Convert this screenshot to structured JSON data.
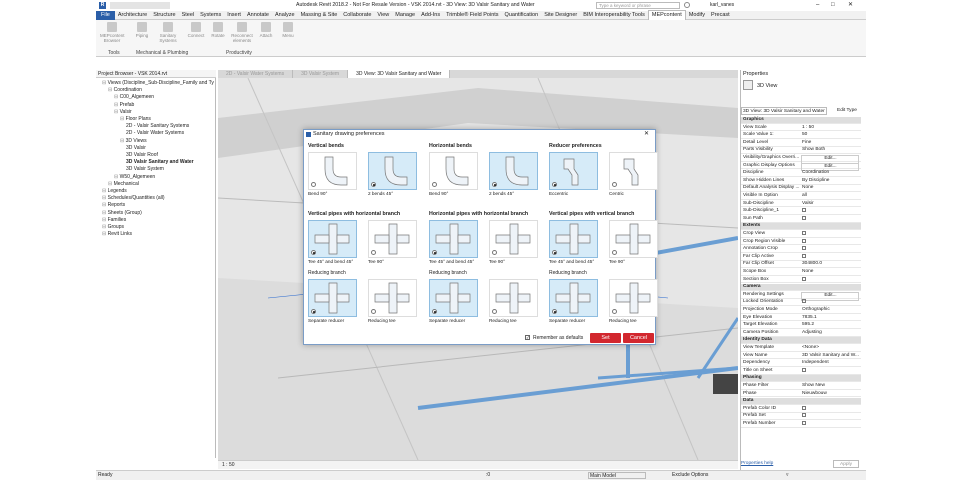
{
  "window": {
    "title": "Autodesk Revit 2018.2 - Not For Resale Version - VSK 2014.rvt - 3D View: 3D Valsir Sanitary and Water",
    "search_placeholder": "Type a keyword or phrase",
    "user": "karl_vanes"
  },
  "ribbon": {
    "tabs": [
      "File",
      "Architecture",
      "Structure",
      "Steel",
      "Systems",
      "Insert",
      "Annotate",
      "Analyze",
      "Massing & Site",
      "Collaborate",
      "View",
      "Manage",
      "Add-Ins",
      "Trimble® Field Points",
      "Quantification",
      "Site Designer",
      "BIM Interoperability Tools",
      "MEPcontent",
      "Modify",
      "Precast"
    ],
    "active_tab": "MEPcontent",
    "buttons": [
      "MEPcontent Browser",
      "Piping",
      "Sanitary Systems",
      "Connect",
      "Rotate",
      "Reconnect elements",
      "Attach",
      "Menu"
    ],
    "panels": [
      "Tools",
      "Mechanical & Plumbing",
      "Productivity"
    ]
  },
  "project_browser": {
    "title": "Project Browser - VSK 2014.rvt",
    "items": [
      {
        "label": "Views (Discipline_Sub-Discipline_Family and Ty",
        "level": 0
      },
      {
        "label": "Coordination",
        "level": 1
      },
      {
        "label": "C00_Algemeen",
        "level": 2
      },
      {
        "label": "Prefab",
        "level": 2
      },
      {
        "label": "Valsir",
        "level": 2
      },
      {
        "label": "Floor Plans",
        "level": 3
      },
      {
        "label": "2D - Valsir Sanitary Systems",
        "level": 4
      },
      {
        "label": "2D - Valsir Water Systems",
        "level": 4
      },
      {
        "label": "3D Views",
        "level": 3
      },
      {
        "label": "3D Valsir",
        "level": 4
      },
      {
        "label": "3D Valsir Roof",
        "level": 4
      },
      {
        "label": "3D Valsir Sanitary and Water",
        "level": 4,
        "bold": true
      },
      {
        "label": "3D Valsir System",
        "level": 4
      },
      {
        "label": "W50_Algemeen",
        "level": 2
      },
      {
        "label": "Mechanical",
        "level": 1
      },
      {
        "label": "Legends",
        "level": 0
      },
      {
        "label": "Schedules/Quantities (all)",
        "level": 0
      },
      {
        "label": "Reports",
        "level": 0
      },
      {
        "label": "Sheets (Group)",
        "level": 0
      },
      {
        "label": "Families",
        "level": 0
      },
      {
        "label": "Groups",
        "level": 0
      },
      {
        "label": "Revit Links",
        "level": 0
      }
    ]
  },
  "view_tabs": [
    "2D - Valsir Water Systems",
    "3D Valsir System",
    "3D View: 3D Valsir Sanitary and Water"
  ],
  "view_controls": {
    "scale": "1 : 50"
  },
  "dialog": {
    "title": "Sanitary drawing preferences",
    "sections": [
      {
        "title": "Vertical bends",
        "options": [
          {
            "caption": "Bend 90°",
            "selected": false
          },
          {
            "caption": "2 bends 45°",
            "selected": true
          }
        ]
      },
      {
        "title": "Horizontal bends",
        "options": [
          {
            "caption": "Bend 90°",
            "selected": false
          },
          {
            "caption": "2 bends 45°",
            "selected": true
          }
        ]
      },
      {
        "title": "Reducer preferences",
        "options": [
          {
            "caption": "Eccentric",
            "selected": true
          },
          {
            "caption": "Centric",
            "selected": false
          }
        ]
      },
      {
        "title": "Vertical pipes with horizontal branch",
        "options": [
          {
            "caption": "Tee 45° and bend 45°",
            "selected": true
          },
          {
            "caption": "Tee 90°",
            "selected": false
          }
        ],
        "sub_title": "Reducing branch",
        "sub_options": [
          {
            "caption": "Separate reducer",
            "selected": true
          },
          {
            "caption": "Reducing tee",
            "selected": false
          }
        ]
      },
      {
        "title": "Horizontal pipes with horizontal branch",
        "options": [
          {
            "caption": "Tee 45° and bend 45°",
            "selected": true
          },
          {
            "caption": "Tee 90°",
            "selected": false
          }
        ],
        "sub_title": "Reducing branch",
        "sub_options": [
          {
            "caption": "Separate reducer",
            "selected": true
          },
          {
            "caption": "Reducing tee",
            "selected": false
          }
        ]
      },
      {
        "title": "Vertical pipes with vertical branch",
        "options": [
          {
            "caption": "Tee 45° and bend 45°",
            "selected": true
          },
          {
            "caption": "Tee 90°",
            "selected": false
          }
        ],
        "sub_title": "Reducing branch",
        "sub_options": [
          {
            "caption": "Separate reducer",
            "selected": true
          },
          {
            "caption": "Reducing tee",
            "selected": false
          }
        ]
      }
    ],
    "remember_label": "Remember as defaults",
    "remember_checked": true,
    "set_label": "Set",
    "cancel_label": "Cancel"
  },
  "properties": {
    "title": "Properties",
    "type_name": "3D View",
    "selector": "3D View: 3D Valsir Sanitary and Water",
    "edit_type": "Edit Type",
    "rows": [
      {
        "section": "Graphics"
      },
      {
        "k": "View Scale",
        "v": "1 : 50"
      },
      {
        "k": "Scale Value 1:",
        "v": "50"
      },
      {
        "k": "Detail Level",
        "v": "Fine"
      },
      {
        "k": "Parts Visibility",
        "v": "Show Both"
      },
      {
        "k": "Visibility/Graphics Overri...",
        "v": "Edit..."
      },
      {
        "k": "Graphic Display Options",
        "v": "Edit..."
      },
      {
        "k": "Discipline",
        "v": "Coordination"
      },
      {
        "k": "Show Hidden Lines",
        "v": "By Discipline"
      },
      {
        "k": "Default Analysis Display ...",
        "v": "None"
      },
      {
        "k": "Visible In Option",
        "v": "all"
      },
      {
        "k": "Sub-Discipline",
        "v": "Valsir"
      },
      {
        "k": "Sub-Discipline_1",
        "v": ""
      },
      {
        "k": "Sun Path",
        "v": ""
      },
      {
        "section": "Extents"
      },
      {
        "k": "Crop View",
        "v": ""
      },
      {
        "k": "Crop Region Visible",
        "v": ""
      },
      {
        "k": "Annotation Crop",
        "v": ""
      },
      {
        "k": "Far Clip Active",
        "v": ""
      },
      {
        "k": "Far Clip Offset",
        "v": "304800.0"
      },
      {
        "k": "Scope Box",
        "v": "None"
      },
      {
        "k": "Section Box",
        "v": ""
      },
      {
        "section": "Camera"
      },
      {
        "k": "Rendering Settings",
        "v": "Edit..."
      },
      {
        "k": "Locked Orientation",
        "v": ""
      },
      {
        "k": "Projection Mode",
        "v": "Orthographic"
      },
      {
        "k": "Eye Elevation",
        "v": "7835.1"
      },
      {
        "k": "Target Elevation",
        "v": "595.2"
      },
      {
        "k": "Camera Position",
        "v": "Adjusting"
      },
      {
        "section": "Identity Data"
      },
      {
        "k": "View Template",
        "v": "<None>"
      },
      {
        "k": "View Name",
        "v": "3D Valsir Sanitary and W..."
      },
      {
        "k": "Dependency",
        "v": "Independent"
      },
      {
        "k": "Title on Sheet",
        "v": ""
      },
      {
        "section": "Phasing"
      },
      {
        "k": "Phase Filter",
        "v": "Show New"
      },
      {
        "k": "Phase",
        "v": "Nieuwbouw"
      },
      {
        "section": "Data"
      },
      {
        "k": "Prefab Color ID",
        "v": ""
      },
      {
        "k": "Prefab Set",
        "v": ""
      },
      {
        "k": "Prefab Number",
        "v": ""
      }
    ],
    "help_link": "Properties help",
    "apply": "Apply"
  },
  "status": {
    "text": "Ready",
    "model": "Main Model",
    "exclude_options": "Exclude Options",
    "zero": ":0"
  }
}
